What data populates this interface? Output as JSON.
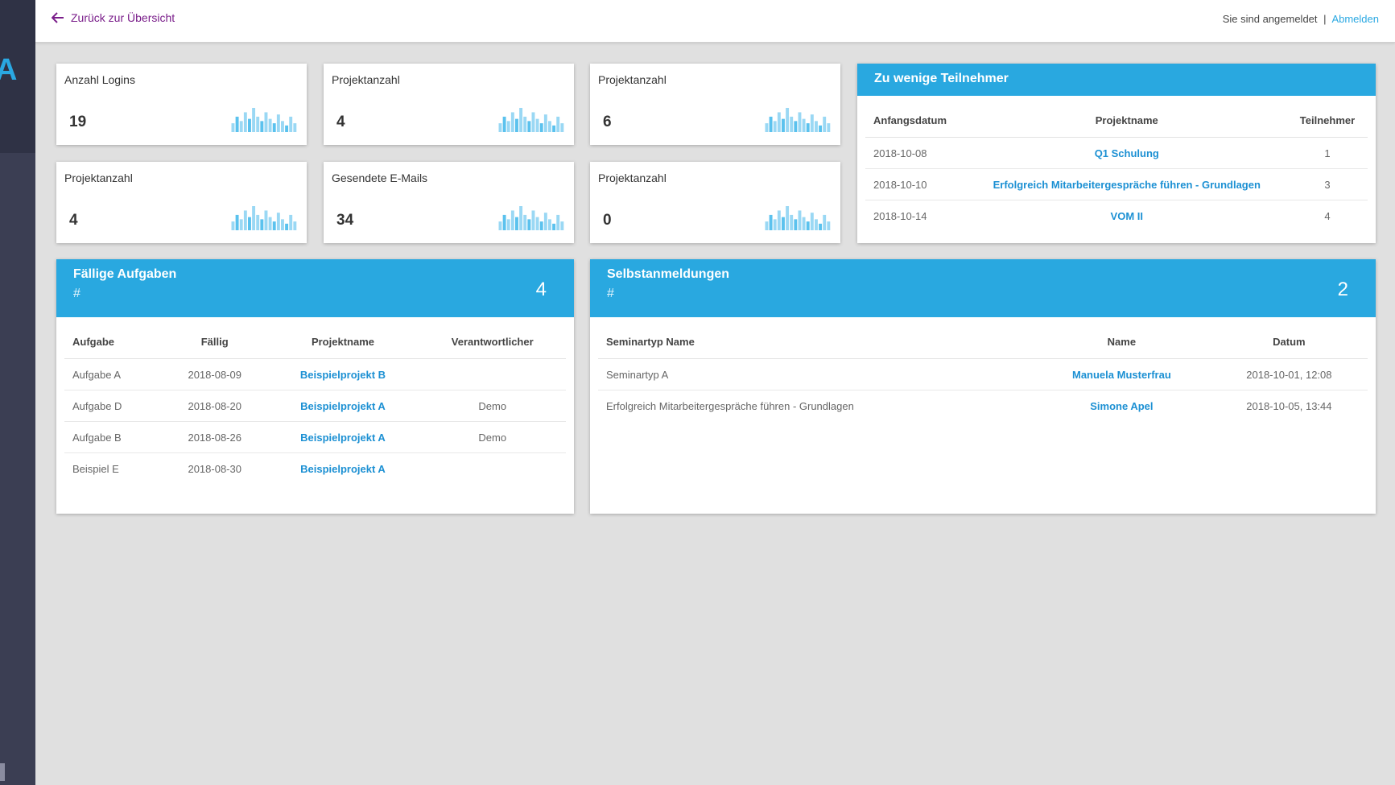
{
  "sidebar": {
    "logo_letter": "A"
  },
  "topbar": {
    "back_label": "Zurück zur Übersicht",
    "status_text": "Sie sind angemeldet",
    "separator": "|",
    "logout_label": "Abmelden"
  },
  "stats": [
    {
      "label": "Anzahl Logins",
      "value": "19"
    },
    {
      "label": "Projektanzahl",
      "value": "4"
    },
    {
      "label": "Projektanzahl",
      "value": "6"
    },
    {
      "label": "Projektanzahl",
      "value": "4"
    },
    {
      "label": "Gesendete E-Mails",
      "value": "34"
    },
    {
      "label": "Projektanzahl",
      "value": "0"
    }
  ],
  "spark_values": [
    4,
    7,
    5,
    9,
    6,
    11,
    7,
    5,
    9,
    6,
    4,
    8,
    5,
    3,
    7,
    4
  ],
  "colors": {
    "accent": "#29a8e0",
    "link": "#1c90d3",
    "back_link": "#7a1e8a",
    "sidebar": "#3b3e53"
  },
  "teilnehmer": {
    "title": "Zu wenige Teilnehmer",
    "headers": [
      "Anfangsdatum",
      "Projektname",
      "Teilnehmer"
    ],
    "rows": [
      {
        "date": "2018-10-08",
        "name": "Q1 Schulung",
        "count": "1"
      },
      {
        "date": "2018-10-10",
        "name": "Erfolgreich Mitarbeitergespräche führen - Grundlagen",
        "count": "3"
      },
      {
        "date": "2018-10-14",
        "name": "VOM II",
        "count": "4"
      }
    ]
  },
  "aufgaben": {
    "title": "Fällige Aufgaben",
    "hash": "#",
    "count": "4",
    "headers": [
      "Aufgabe",
      "Fällig",
      "Projektname",
      "Verantwortlicher"
    ],
    "rows": [
      {
        "task": "Aufgabe A",
        "due": "2018-08-09",
        "project": "Beispielprojekt B",
        "owner": ""
      },
      {
        "task": "Aufgabe D",
        "due": "2018-08-20",
        "project": "Beispielprojekt A",
        "owner": "Demo"
      },
      {
        "task": "Aufgabe B",
        "due": "2018-08-26",
        "project": "Beispielprojekt A",
        "owner": "Demo"
      },
      {
        "task": "Beispiel E",
        "due": "2018-08-30",
        "project": "Beispielprojekt A",
        "owner": ""
      }
    ]
  },
  "selbst": {
    "title": "Selbstanmeldungen",
    "hash": "#",
    "count": "2",
    "headers": [
      "Seminartyp Name",
      "Name",
      "Datum"
    ],
    "rows": [
      {
        "type": "Seminartyp A",
        "name": "Manuela Musterfrau",
        "date": "2018-10-01, 12:08"
      },
      {
        "type": "Erfolgreich Mitarbeitergespräche führen - Grundlagen",
        "name": "Simone Apel",
        "date": "2018-10-05, 13:44"
      }
    ]
  }
}
